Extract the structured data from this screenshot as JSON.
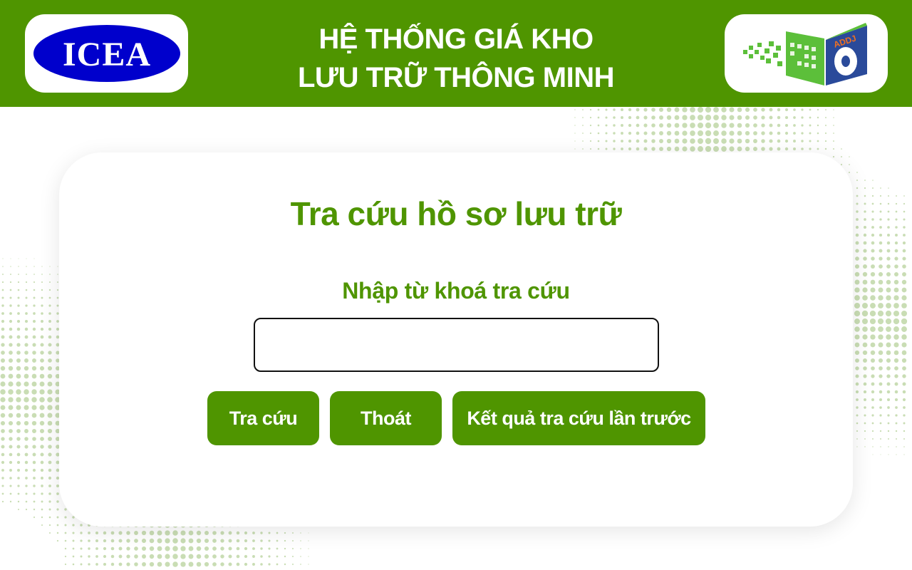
{
  "header": {
    "title_line1": "HỆ THỐNG GIÁ KHO",
    "title_line2": "LƯU TRỮ THÔNG MINH",
    "logo_left_text": "ICEA",
    "logo_right_text": "ADDJ"
  },
  "main": {
    "title": "Tra cứu hồ sơ lưu trữ",
    "search_label": "Nhập từ khoá tra cứu",
    "search_value": "",
    "search_placeholder": "",
    "buttons": {
      "search": "Tra cứu",
      "exit": "Thoát",
      "previous_results": "Kết quả tra cứu lần trước"
    }
  },
  "colors": {
    "brand_green": "#4f9500",
    "white": "#ffffff",
    "icea_blue": "#0000cc",
    "logo_light_green": "#5cbf3a",
    "logo_navy": "#2a4a9a",
    "logo_orange": "#f07020"
  }
}
